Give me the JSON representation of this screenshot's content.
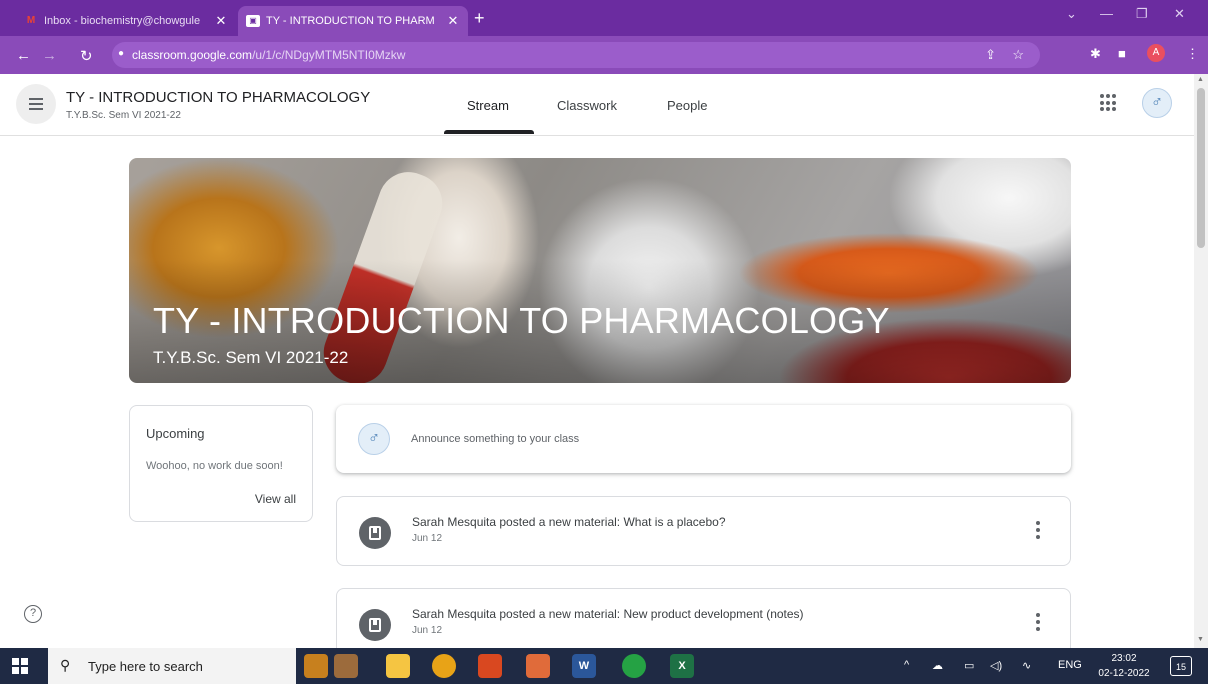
{
  "browser": {
    "tabs": [
      {
        "title": "Inbox - biochemistry@chowgule",
        "close": "✕"
      },
      {
        "title": "TY - INTRODUCTION TO PHARM",
        "close": "✕"
      }
    ],
    "new_tab": "+",
    "url_host": "classroom.google.com",
    "url_path": "/u/1/c/NDgyMTM5NTI0Mzkw",
    "profile_initial": "A"
  },
  "classroom": {
    "header_title": "TY - INTRODUCTION TO PHARMACOLOGY",
    "header_subtitle": "T.Y.B.Sc. Sem VI 2021-22",
    "tabs": [
      "Stream",
      "Classwork",
      "People"
    ],
    "active_tab": "Stream",
    "banner_title": "TY - INTRODUCTION TO PHARMACOLOGY",
    "banner_subtitle": "T.Y.B.Sc. Sem VI 2021-22",
    "upcoming": {
      "heading": "Upcoming",
      "message": "Woohoo, no work due soon!",
      "view_all": "View all"
    },
    "announce_placeholder": "Announce something to your class",
    "posts": [
      {
        "text": "Sarah Mesquita posted a new material: What is a placebo?",
        "date": "Jun 12"
      },
      {
        "text": "Sarah Mesquita posted a new material: New product development (notes)",
        "date": "Jun 12"
      }
    ],
    "help": "?"
  },
  "taskbar": {
    "search_placeholder": "Type here to search",
    "language": "ENG",
    "time": "23:02",
    "date": "02-12-2022",
    "notification_count": "15"
  },
  "colors": {
    "tabstrip": "#6b2ca0",
    "toolbar": "#8a4bb9",
    "taskbar": "#1f2a44"
  }
}
